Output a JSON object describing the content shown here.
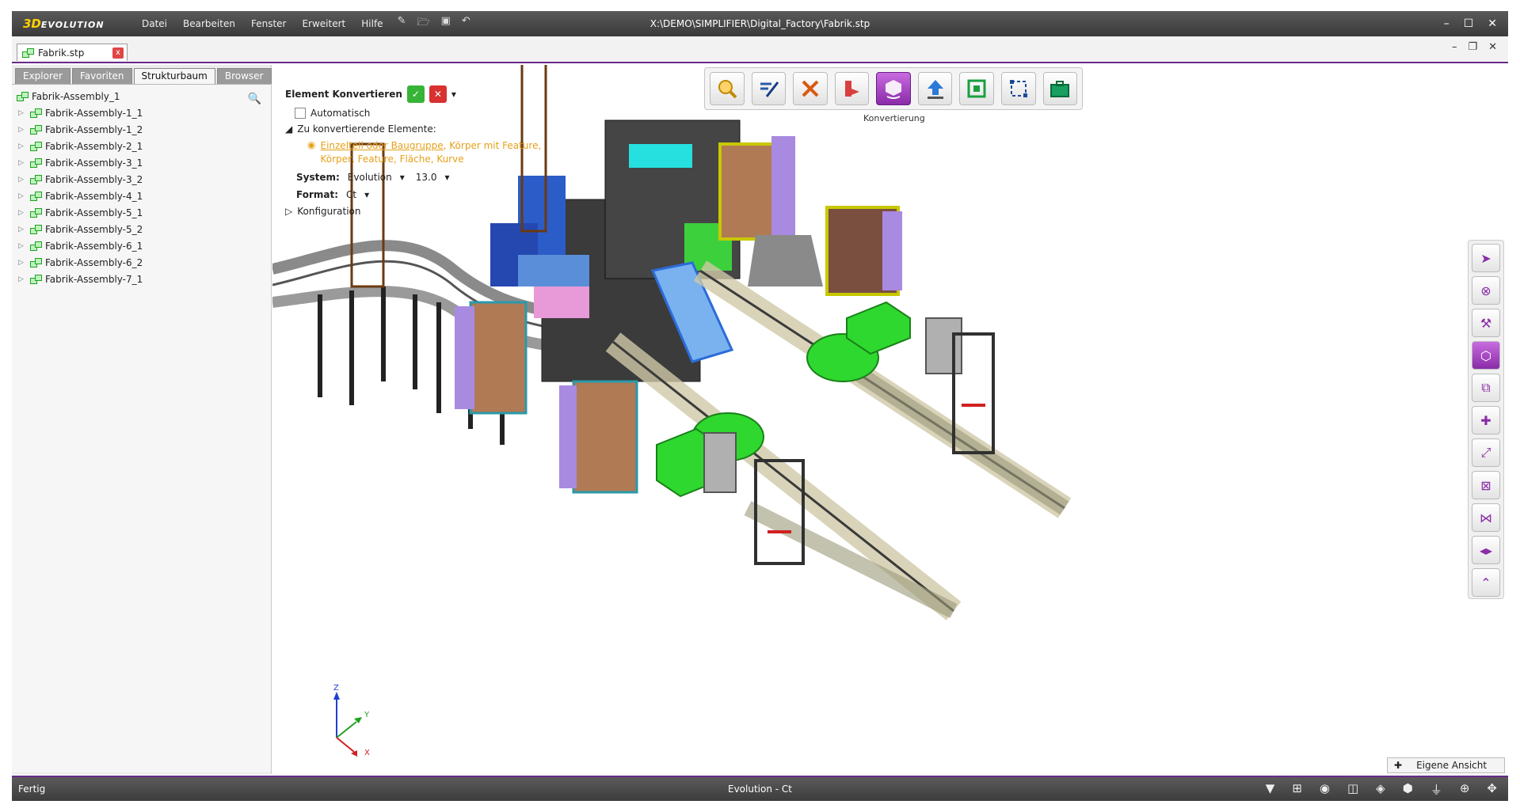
{
  "app": {
    "logo_3d": "3D",
    "logo_text": "EVOLUTION"
  },
  "menu": [
    "Datei",
    "Bearbeiten",
    "Fenster",
    "Erweitert",
    "Hilfe"
  ],
  "window": {
    "title": "X:\\DEMO\\SIMPLIFIER\\Digital_Factory\\Fabrik.stp",
    "minimize": "–",
    "maximize": "☐",
    "close": "✕"
  },
  "doc_tab": {
    "label": "Fabrik.stp",
    "close": "x"
  },
  "panel_tabs": [
    "Explorer",
    "Favoriten",
    "Strukturbaum",
    "Browser"
  ],
  "panel_active": "Strukturbaum",
  "tree": {
    "root": "Fabrik-Assembly_1",
    "items": [
      "Fabrik-Assembly-1_1",
      "Fabrik-Assembly-1_2",
      "Fabrik-Assembly-2_1",
      "Fabrik-Assembly-3_1",
      "Fabrik-Assembly-3_2",
      "Fabrik-Assembly-4_1",
      "Fabrik-Assembly-5_1",
      "Fabrik-Assembly-5_2",
      "Fabrik-Assembly-6_1",
      "Fabrik-Assembly-6_2",
      "Fabrik-Assembly-7_1"
    ]
  },
  "conversion": {
    "title": "Element Konvertieren",
    "auto_label": "Automatisch",
    "elements_label": "Zu konvertierende Elemente:",
    "elements_link": "Einzelteil oder Baugruppe",
    "elements_rest": ", Körper mit Feature, Körper, Feature, Fläche, Kurve",
    "system_label": "System:",
    "system_value": "Evolution",
    "version_value": "13.0",
    "format_label": "Format:",
    "format_value": "Ct",
    "config_label": "Konfiguration"
  },
  "ribbon": {
    "active_label": "Konvertierung"
  },
  "triad": {
    "x": "X",
    "y": "Y",
    "z": "Z"
  },
  "own_view": "Eigene Ansicht",
  "status": {
    "left": "Fertig",
    "center": "Evolution - Ct"
  },
  "colors": {
    "accent": "#8a2ca8",
    "warning": "#e5a11a",
    "ok": "#37b437",
    "cancel": "#d93030"
  }
}
